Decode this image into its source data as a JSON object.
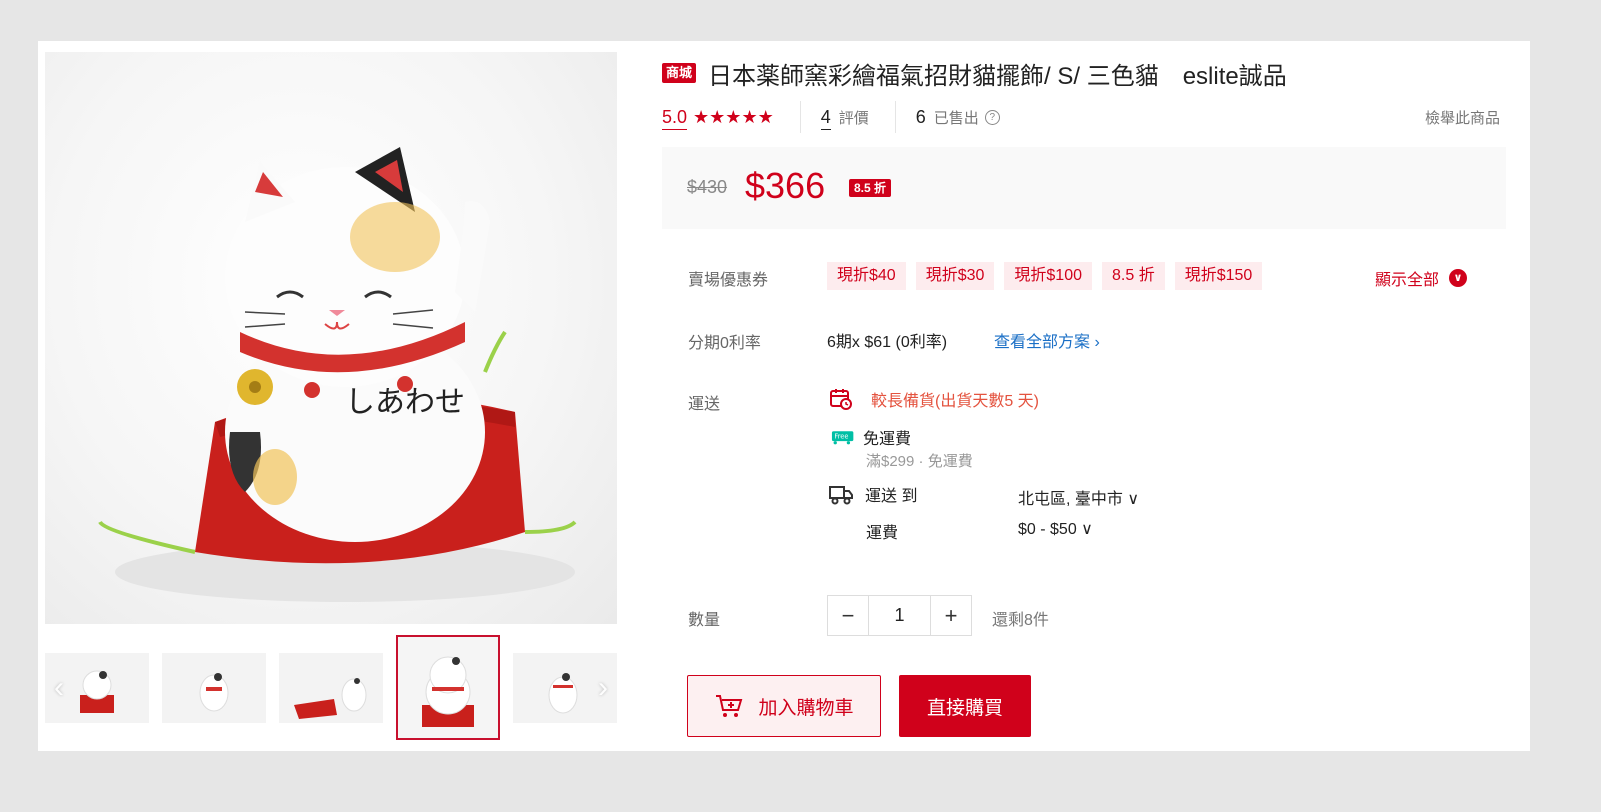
{
  "product": {
    "mall_badge": "商城",
    "title": "日本薬師窯彩繪福氣招財貓擺飾/ S/ 三色貓　eslite誠品"
  },
  "rating": {
    "score": "5.0",
    "stars": "★★★★★",
    "review_count": "4",
    "review_label": "評價",
    "sold_count": "6",
    "sold_label": "已售出",
    "help_icon": "?",
    "report_label": "檢舉此商品"
  },
  "price": {
    "original": "$430",
    "current": "$366",
    "discount": "8.5 折"
  },
  "coupons": {
    "label": "賣場優惠券",
    "items": [
      "現折$40",
      "現折$30",
      "現折$100",
      "8.5 折",
      "現折$150"
    ],
    "show_all": "顯示全部",
    "show_all_icon": "chevron-down-circle"
  },
  "installment": {
    "label": "分期0利率",
    "text": "6期x $61 (0利率)",
    "link": "查看全部方案 ›"
  },
  "shipping": {
    "label": "運送",
    "long_prep": "較長備貨(出貨天數5 天)",
    "free_title": "免運費",
    "free_badge": "Free",
    "free_sub": "滿$299 · 免運費",
    "ship_to_label": "運送 到",
    "ship_to_value": "北屯區, 臺中市 ∨",
    "fee_label": "運費",
    "fee_value": "$0 - $50 ∨"
  },
  "quantity": {
    "label": "數量",
    "minus": "−",
    "value": "1",
    "plus": "+",
    "stock": "還剩8件"
  },
  "actions": {
    "add_to_cart": "加入購物車",
    "buy_now": "直接購買"
  },
  "gallery": {
    "prev_arrow": "‹",
    "next_arrow": "›"
  },
  "colors": {
    "accent": "#d0011b",
    "link": "#1a6fc6",
    "warning": "#e4533f"
  }
}
